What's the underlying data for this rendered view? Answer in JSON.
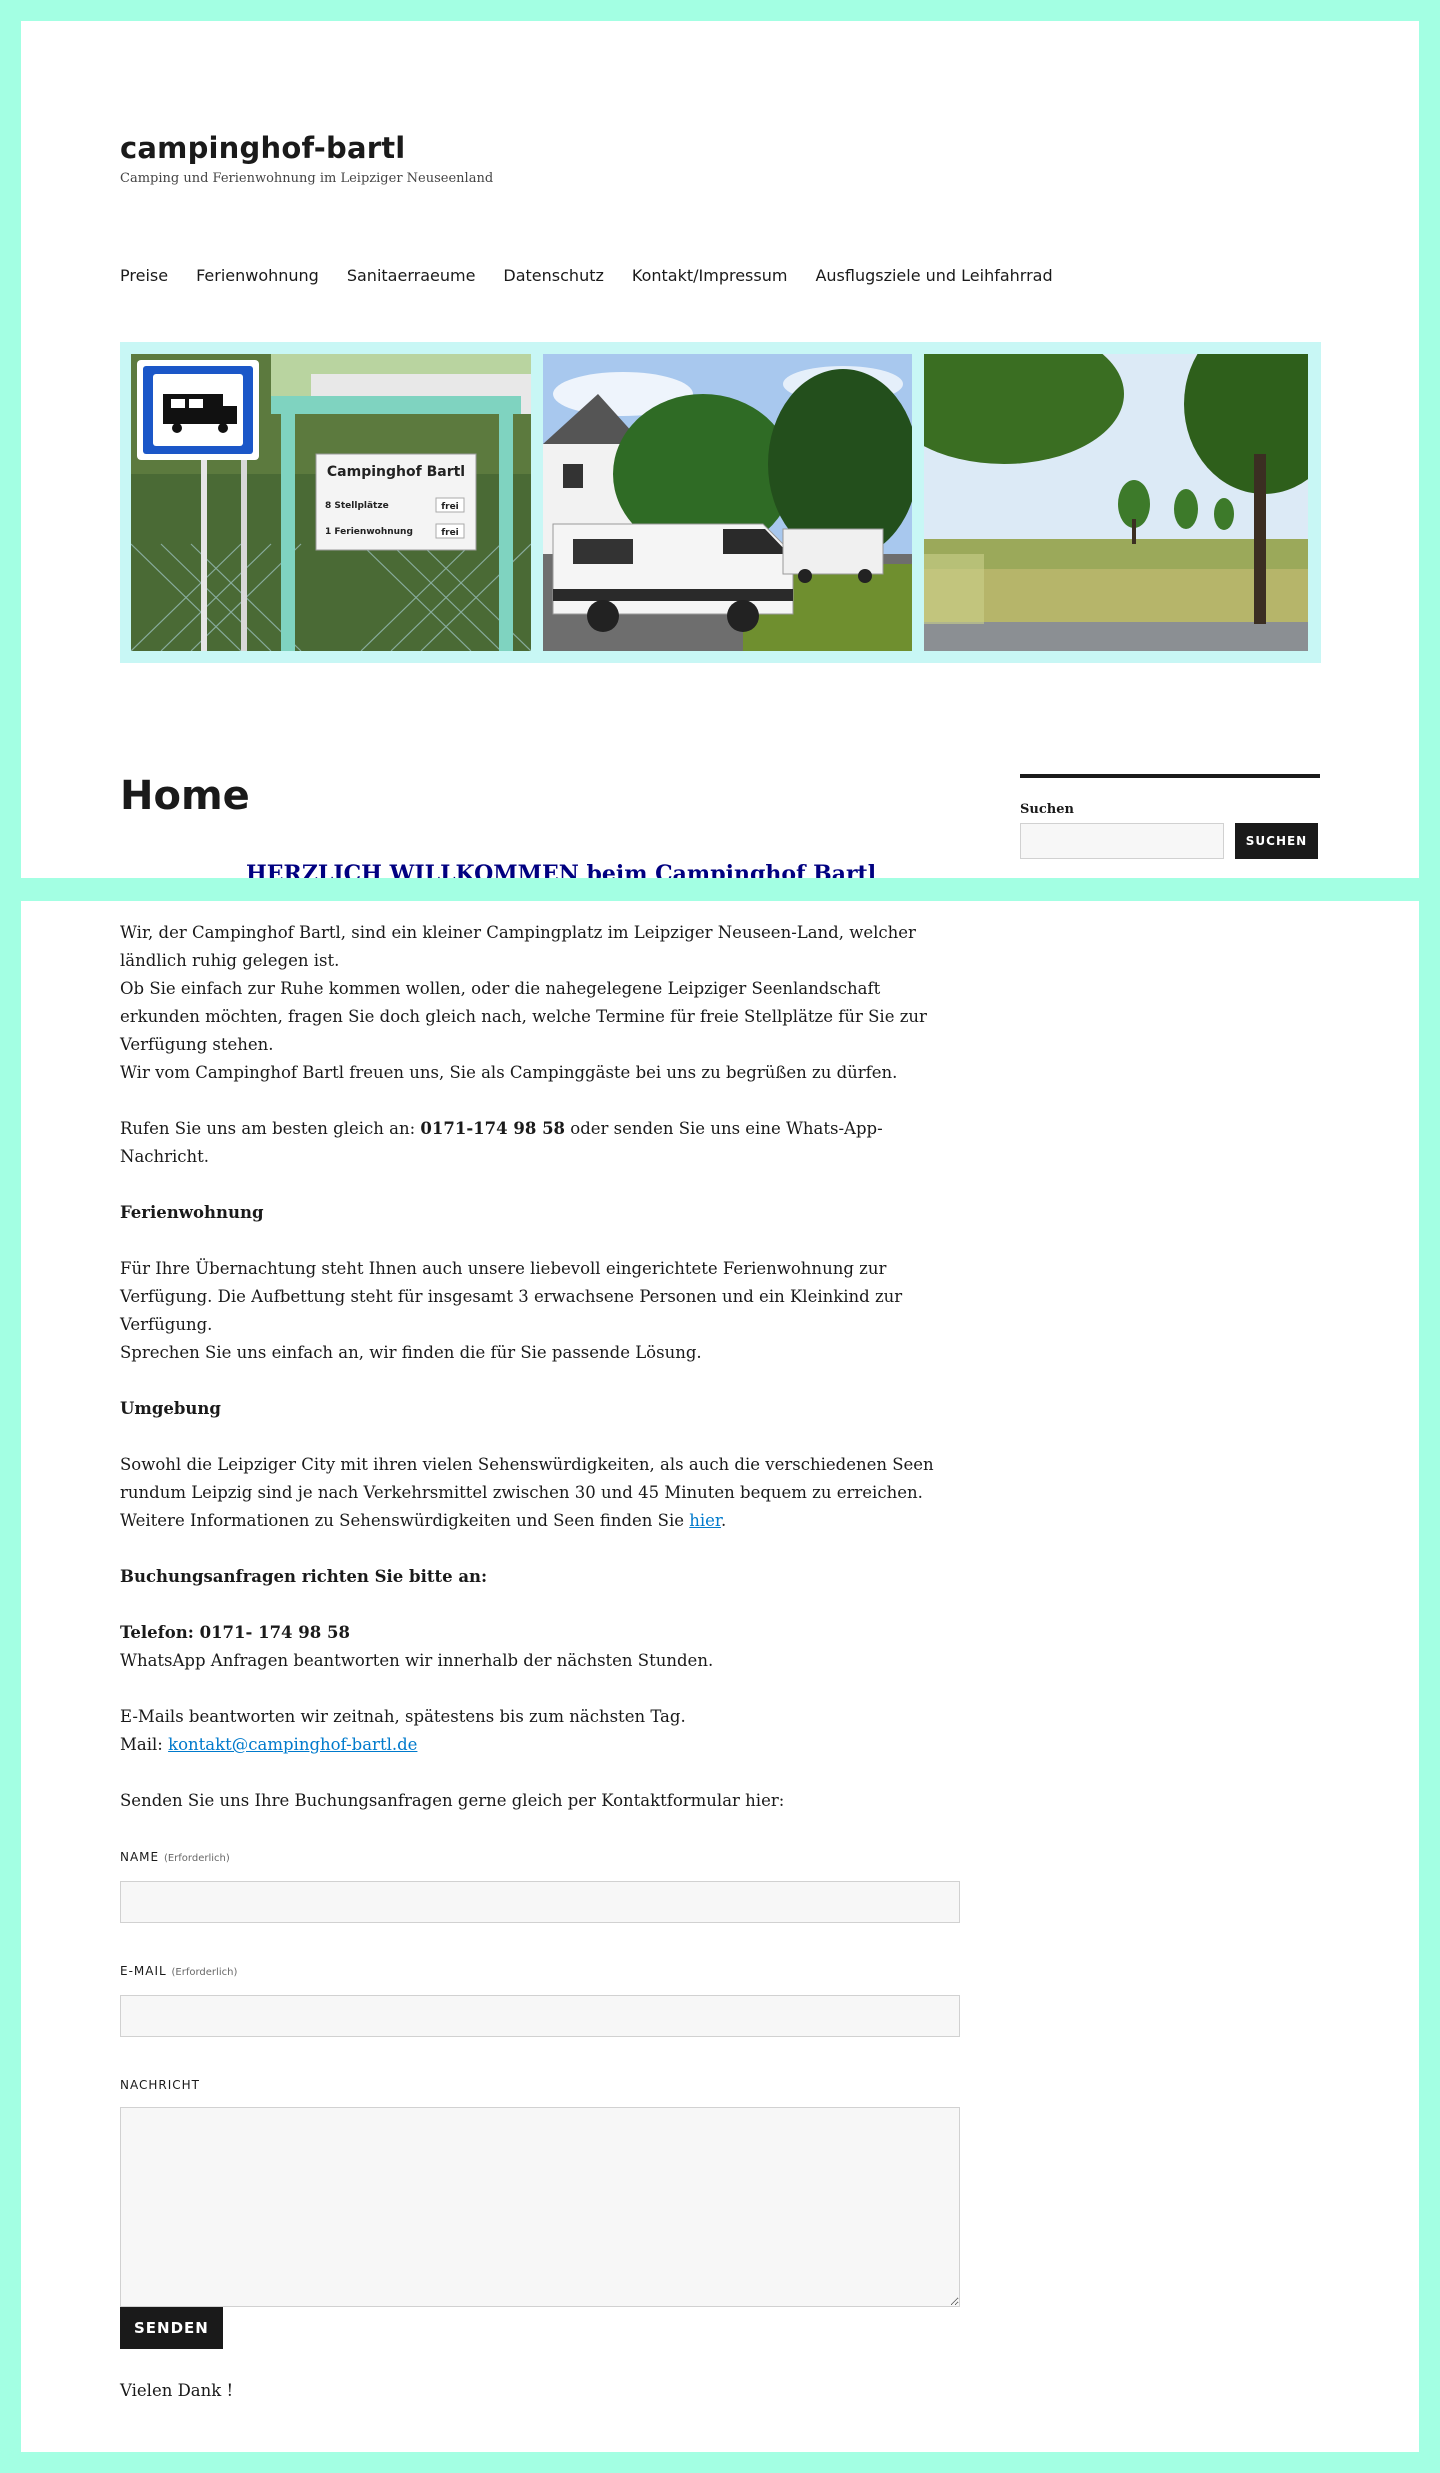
{
  "site": {
    "title": "campinghof-bartl",
    "description": "Camping und Ferienwohnung im Leipziger Neuseenland"
  },
  "nav": {
    "items": [
      "Preise",
      "Ferienwohnung",
      "Sanitaerraeume",
      "Datenschutz",
      "Kontakt/Impressum",
      "Ausflugsziele und Leihfahrrad"
    ]
  },
  "header_image": {
    "sign_title": "Campinghof Bartl",
    "sign_row1": "8 Stellplätze",
    "sign_row1_status": "frei",
    "sign_row2": "1 Ferienwohnung",
    "sign_row2_status": "frei"
  },
  "page": {
    "title": "Home",
    "welcome": "HERZLICH WILLKOMMEN beim Campinghof Bartl"
  },
  "sidebar": {
    "search_label": "Suchen",
    "search_button": "SUCHEN"
  },
  "content": {
    "intro_1": "Wir, der Campinghof Bartl, sind ein kleiner Campingplatz im Leipziger Neuseen-Land, welcher ländlich ruhig gelegen ist.",
    "intro_2": "Ob Sie einfach zur Ruhe kommen wollen, oder die nahegelegene Leipziger Seenlandschaft erkunden möchten, fragen Sie doch gleich nach, welche Termine für freie Stellplätze für Sie zur Verfügung stehen.",
    "intro_3": "Wir vom Campinghof Bartl freuen uns, Sie als Campinggäste bei uns zu begrüßen zu dürfen.",
    "call_prefix": "Rufen Sie uns am besten gleich an: ",
    "call_phone": "0171-174 98 58",
    "call_suffix": " oder senden Sie uns eine Whats-App-Nachricht.",
    "fewo_heading": "Ferienwohnung",
    "fewo_1": "Für Ihre Übernachtung steht Ihnen auch unsere liebevoll eingerichtete Ferienwohnung zur Verfügung. Die Aufbettung steht für insgesamt 3 erwachsene Personen und ein Kleinkind zur Verfügung.",
    "fewo_2": "Sprechen Sie uns einfach an, wir finden die für Sie passende Lösung.",
    "umgebung_heading": "Umgebung",
    "umgebung_1": "Sowohl die Leipziger City mit ihren vielen Sehenswürdigkeiten, als auch die verschiedenen Seen rundum Leipzig sind je nach Verkehrsmittel zwischen 30 und 45 Minuten bequem zu erreichen.",
    "umgebung_2_prefix": "Weitere Informationen zu Sehenswürdigkeiten und Seen finden Sie ",
    "umgebung_link": "hier",
    "umgebung_2_suffix": ".",
    "booking_heading": "Buchungsanfragen richten Sie bitte an:",
    "phone_line": "Telefon: 0171- 174 98 58",
    "whatsapp_line": "WhatsApp Anfragen beantworten wir innerhalb der nächsten Stunden.",
    "email_line": "E-Mails beantworten wir zeitnah, spätestens bis zum nächsten Tag.",
    "mail_prefix": "Mail: ",
    "mail_address": "kontakt@campinghof-bartl.de",
    "form_intro": "Senden Sie uns Ihre Buchungsanfragen gerne gleich per Kontaktformular hier:",
    "thanks": "Vielen Dank !"
  },
  "form": {
    "name_label": "NAME",
    "email_label": "E-MAIL",
    "required_note": "(Erforderlich)",
    "message_label": "NACHRICHT",
    "submit_label": "SENDEN"
  },
  "colors": {
    "frame": "#a3ffe3",
    "header_image_bg": "#c8f7f5",
    "welcome": "#000080",
    "link": "#007acc"
  }
}
